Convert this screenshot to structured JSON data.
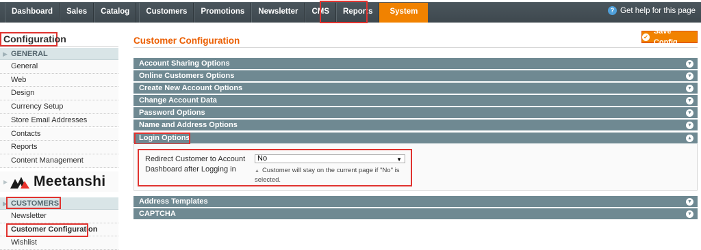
{
  "nav": {
    "items": [
      "Dashboard",
      "Sales",
      "Catalog",
      "Customers",
      "Promotions",
      "Newsletter",
      "CMS",
      "Reports",
      "System"
    ],
    "active": "System",
    "help_label": "Get help for this page"
  },
  "sidebar": {
    "title": "Configuration",
    "general": {
      "heading": "GENERAL",
      "items": [
        "General",
        "Web",
        "Design",
        "Currency Setup",
        "Store Email Addresses",
        "Contacts",
        "Reports",
        "Content Management"
      ]
    },
    "logo_text": "Meetanshi",
    "customers": {
      "heading": "CUSTOMERS",
      "items": [
        "Newsletter",
        "Customer Configuration",
        "Wishlist"
      ]
    }
  },
  "main": {
    "title": "Customer Configuration",
    "save_label": "Save Config",
    "sections": [
      "Account Sharing Options",
      "Online Customers Options",
      "Create New Account Options",
      "Change Account Data",
      "Password Options",
      "Name and Address Options",
      "Login Options"
    ],
    "login": {
      "field_label": "Redirect Customer to Account Dashboard after Logging in",
      "value": "No",
      "note": "Customer will stay on the current page if \"No\" is selected."
    },
    "sections_after": [
      "Address Templates",
      "CAPTCHA"
    ]
  },
  "colors": {
    "accent_orange": "#f18200",
    "title_orange": "#eb5e00",
    "section_header": "#6f8992",
    "highlight_red": "#e0332f"
  }
}
